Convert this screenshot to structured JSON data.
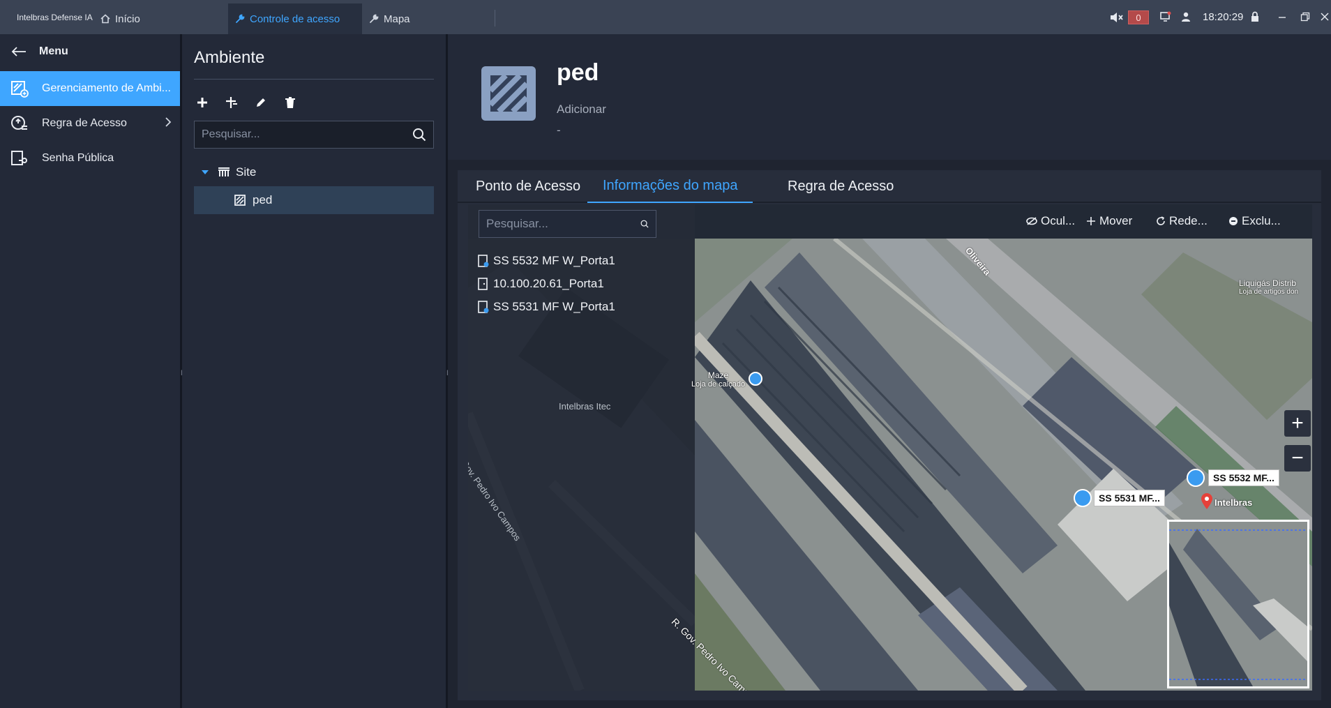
{
  "app": {
    "name": "Intelbras Defense IA"
  },
  "tabs": [
    {
      "label": "Início"
    },
    {
      "label": "Controle de acesso"
    },
    {
      "label": "Mapa"
    }
  ],
  "status": {
    "alarm_count": "0",
    "time": "18:20:29"
  },
  "menu": {
    "title": "Menu",
    "items": [
      {
        "label": "Gerenciamento de Ambi..."
      },
      {
        "label": "Regra de Acesso"
      },
      {
        "label": "Senha Pública"
      }
    ]
  },
  "ambiente": {
    "title": "Ambiente",
    "search_placeholder": "Pesquisar...",
    "tree": {
      "root": "Site",
      "child": "ped"
    }
  },
  "detail": {
    "title": "ped",
    "subtitle": "Adicionar",
    "description": "-"
  },
  "content_tabs": [
    {
      "label": "Ponto de Acesso"
    },
    {
      "label": "Informações do mapa"
    },
    {
      "label": "Regra de Acesso"
    }
  ],
  "map": {
    "search_placeholder": "Pesquisar...",
    "tools": [
      {
        "label": "Ocul..."
      },
      {
        "label": "Mover"
      },
      {
        "label": "Rede..."
      },
      {
        "label": "Exclu..."
      }
    ],
    "devices": [
      {
        "label": "SS 5532 MF W_Porta1"
      },
      {
        "label": "10.100.20.61_Porta1"
      },
      {
        "label": "SS 5531 MF W_Porta1"
      }
    ],
    "labels": {
      "street_top": "Oliveira",
      "store_name": "Maze",
      "store_sub": "Loja de calçado",
      "corner_name": "Liquigás Distrib",
      "corner_sub": "Loja de artigos don",
      "street_main": "R. Gov. Pedro Ivo Campos",
      "street_left": "R. Gov. Pedro Ivo Campos",
      "intelbras_faded": "Intelbras Itec",
      "brand_pin": "Intelbras",
      "marker_1": "SS 5532 MF...",
      "marker_2": "SS 5531 MF..."
    }
  },
  "colors": {
    "accent": "#3fa6ff",
    "topbar": "#3a4354",
    "panel": "#232938",
    "alarm": "#b44a4a"
  }
}
